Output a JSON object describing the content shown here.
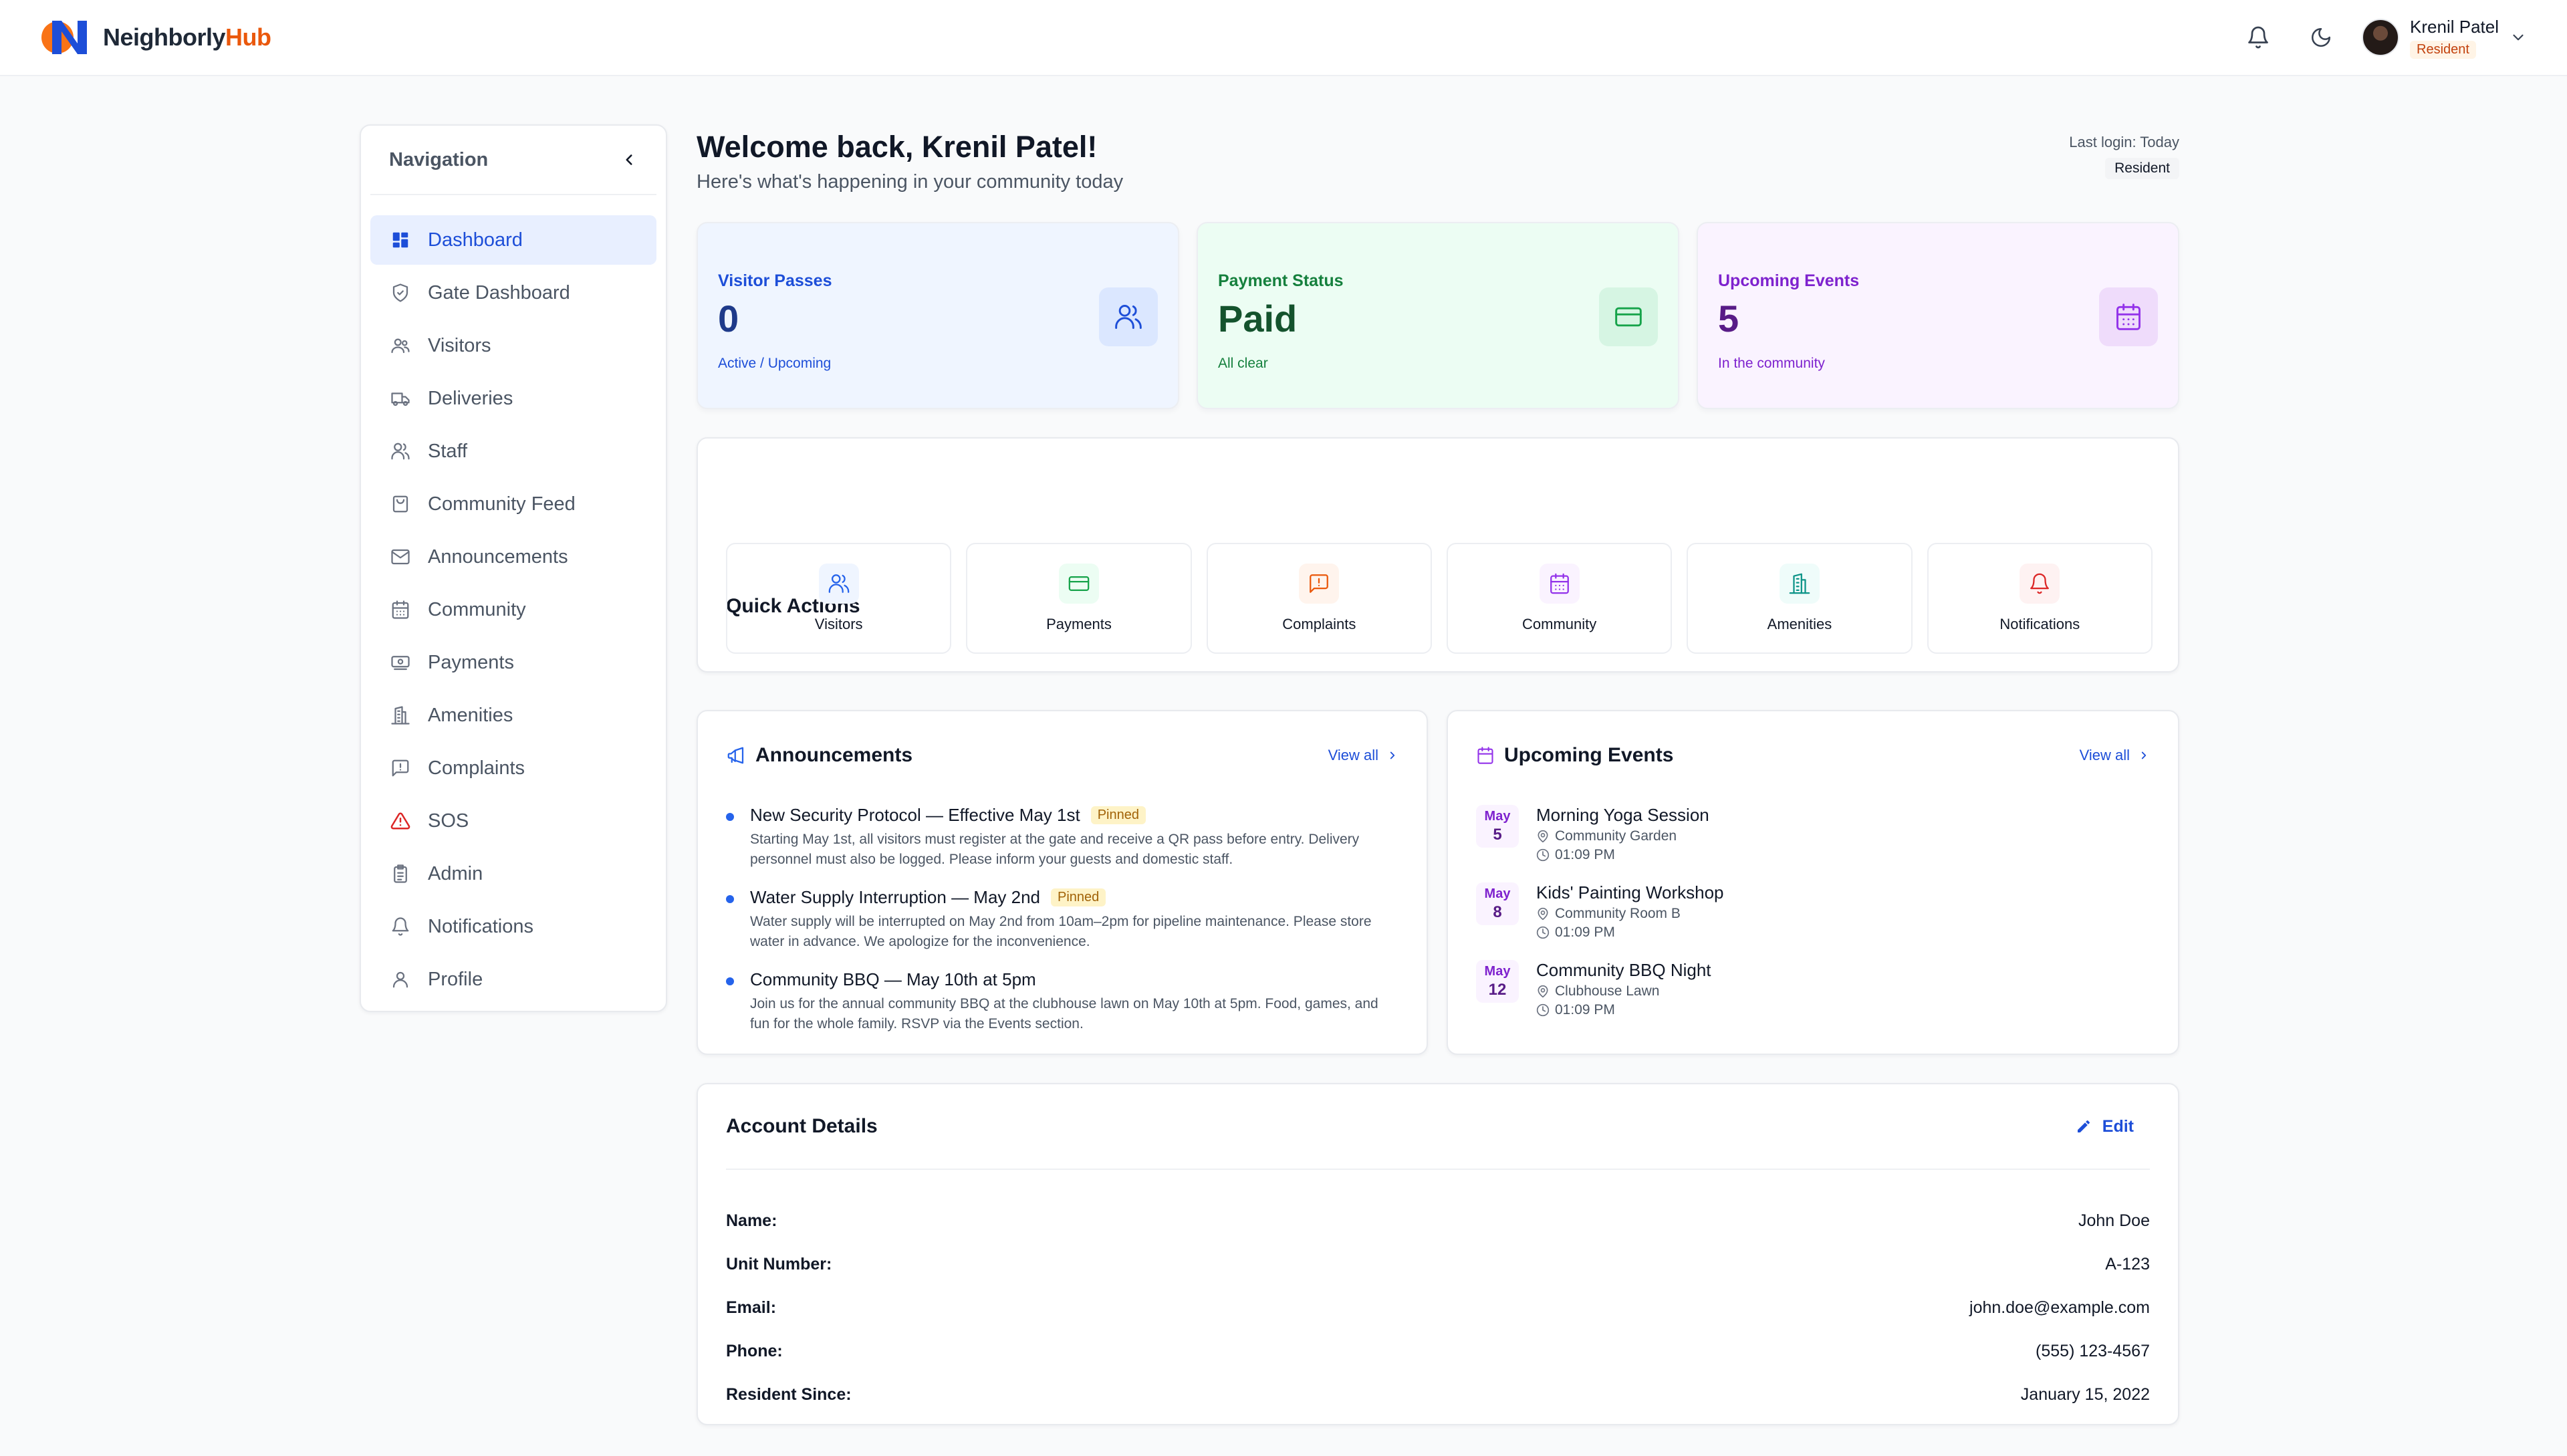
{
  "app": {
    "logo_part1": "Neighborly",
    "logo_part2": "Hub",
    "brand_colors": {
      "logo_orange": "#ea580c",
      "logo_blue": "#1d4ed8"
    }
  },
  "header": {
    "user_name": "Krenil Patel",
    "user_role": "Resident",
    "icons": [
      "bell-icon",
      "moon-icon",
      "chevron-down-icon"
    ]
  },
  "sidebar": {
    "title": "Navigation",
    "items": [
      {
        "label": "Dashboard",
        "icon": "dashboard-icon",
        "active": true
      },
      {
        "label": "Gate Dashboard",
        "icon": "shield-icon"
      },
      {
        "label": "Visitors",
        "icon": "users-icon"
      },
      {
        "label": "Deliveries",
        "icon": "truck-icon"
      },
      {
        "label": "Staff",
        "icon": "user-group-icon"
      },
      {
        "label": "Community Feed",
        "icon": "shopping-bag-icon"
      },
      {
        "label": "Announcements",
        "icon": "mail-icon"
      },
      {
        "label": "Community",
        "icon": "calendar-icon"
      },
      {
        "label": "Payments",
        "icon": "cash-icon"
      },
      {
        "label": "Amenities",
        "icon": "building-icon"
      },
      {
        "label": "Complaints",
        "icon": "message-alert-icon"
      },
      {
        "label": "SOS",
        "icon": "warning-icon"
      },
      {
        "label": "Admin",
        "icon": "clipboard-icon"
      },
      {
        "label": "Notifications",
        "icon": "bell-icon"
      },
      {
        "label": "Profile",
        "icon": "user-icon"
      }
    ]
  },
  "welcome": {
    "title": "Welcome back, Krenil Patel!",
    "subtitle": "Here's what's happening in your community today",
    "last_login": "Last login: Today",
    "role_badge": "Resident"
  },
  "stats": [
    {
      "label": "Visitor Passes",
      "value": "0",
      "foot": "Active / Upcoming",
      "icon": "users-icon",
      "color": "#1d4ed8"
    },
    {
      "label": "Payment Status",
      "value": "Paid",
      "foot": "All clear",
      "icon": "credit-card-icon",
      "color": "#15803d"
    },
    {
      "label": "Upcoming Events",
      "value": "5",
      "foot": "In the community",
      "icon": "calendar-icon",
      "color": "#7e22ce"
    }
  ],
  "quick_actions": {
    "title": "Quick Actions",
    "items": [
      {
        "label": "Visitors",
        "icon": "users-icon",
        "color": "#2563eb"
      },
      {
        "label": "Payments",
        "icon": "credit-card-icon",
        "color": "#16a34a"
      },
      {
        "label": "Complaints",
        "icon": "message-alert-icon",
        "color": "#ea580c"
      },
      {
        "label": "Community",
        "icon": "calendar-icon",
        "color": "#9333ea"
      },
      {
        "label": "Amenities",
        "icon": "building-icon",
        "color": "#0d9488"
      },
      {
        "label": "Notifications",
        "icon": "bell-icon",
        "color": "#dc2626"
      }
    ]
  },
  "announcements": {
    "title": "Announcements",
    "view_all": "View all",
    "items": [
      {
        "title": "New Security Protocol — Effective May 1st",
        "badge": "Pinned",
        "body": "Starting May 1st, all visitors must register at the gate and receive a QR pass before entry. Delivery personnel must also be logged. Please inform your guests and domestic staff."
      },
      {
        "title": "Water Supply Interruption — May 2nd",
        "badge": "Pinned",
        "body": "Water supply will be interrupted on May 2nd from 10am–2pm for pipeline maintenance. Please store water in advance. We apologize for the inconvenience."
      },
      {
        "title": "Community BBQ — May 10th at 5pm",
        "badge": "",
        "body": "Join us for the annual community BBQ at the clubhouse lawn on May 10th at 5pm. Food, games, and fun for the whole family. RSVP via the Events section."
      }
    ]
  },
  "events": {
    "title": "Upcoming Events",
    "view_all": "View all",
    "items": [
      {
        "month": "May",
        "day": "5",
        "name": "Morning Yoga Session",
        "location": "Community Garden",
        "time": "01:09 PM"
      },
      {
        "month": "May",
        "day": "8",
        "name": "Kids' Painting Workshop",
        "location": "Community Room B",
        "time": "01:09 PM"
      },
      {
        "month": "May",
        "day": "12",
        "name": "Community BBQ Night",
        "location": "Clubhouse Lawn",
        "time": "01:09 PM"
      }
    ]
  },
  "account": {
    "title": "Account Details",
    "edit_label": "Edit",
    "rows": [
      {
        "key": "Name:",
        "value": "John Doe"
      },
      {
        "key": "Unit Number:",
        "value": "A-123"
      },
      {
        "key": "Email:",
        "value": "john.doe@example.com"
      },
      {
        "key": "Phone:",
        "value": "(555) 123-4567"
      },
      {
        "key": "Resident Since:",
        "value": "January 15, 2022"
      }
    ]
  }
}
